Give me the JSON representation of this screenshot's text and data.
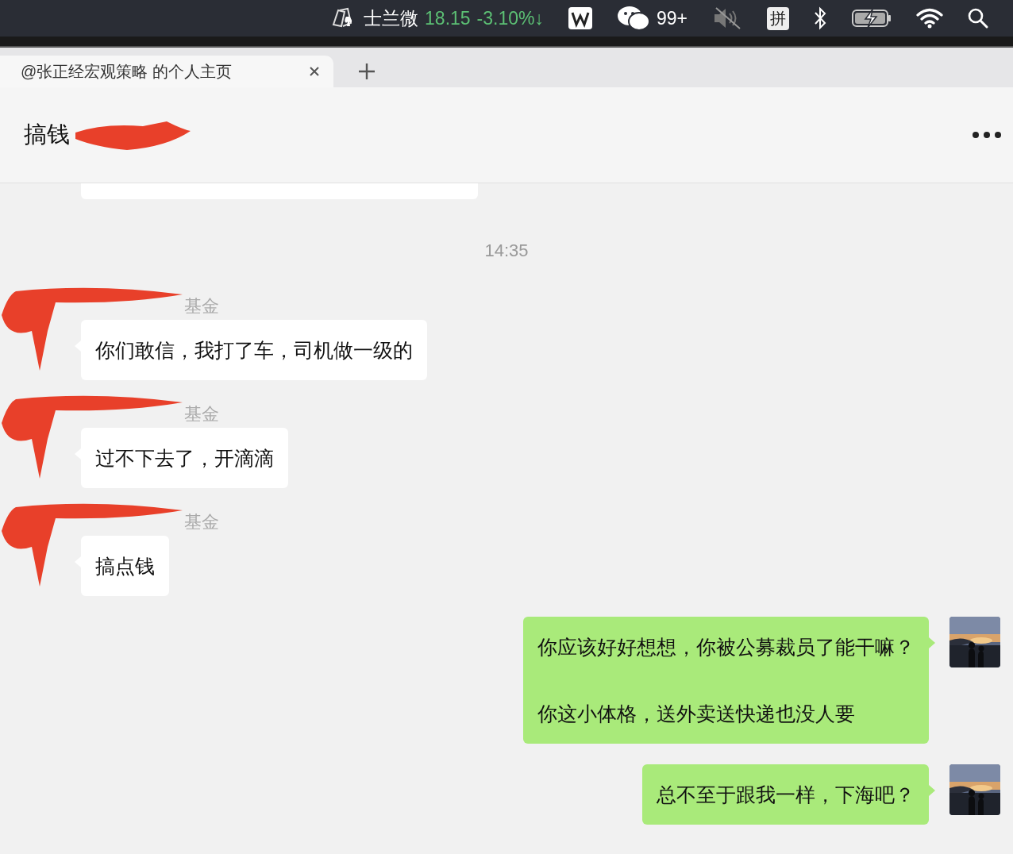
{
  "menu_bar": {
    "stock": {
      "name": "士兰微",
      "price": "18.15",
      "change": "-3.10%↓"
    },
    "wechat_badge": "99+",
    "input_method": "拼"
  },
  "browser_tab": {
    "title": "@张正经宏观策略 的个人主页",
    "selected": true
  },
  "chat": {
    "title": "搞钱",
    "time": "14:35",
    "messages": [
      {
        "kind": "incoming",
        "sender": "基金",
        "redacted": true,
        "lines": [
          "你们敢信，我打了车，司机做一级的"
        ]
      },
      {
        "kind": "incoming",
        "sender": "基金",
        "redacted": true,
        "lines": [
          "过不下去了，开滴滴"
        ]
      },
      {
        "kind": "incoming",
        "sender": "基金",
        "redacted": true,
        "lines": [
          "搞点钱"
        ]
      },
      {
        "kind": "outgoing",
        "lines": [
          "你应该好好想想，你被公募裁员了能干嘛？",
          "你这小体格，送外卖送快递也没人要"
        ]
      },
      {
        "kind": "outgoing",
        "lines": [
          "总不至于跟我一样，下海吧？"
        ]
      }
    ]
  }
}
